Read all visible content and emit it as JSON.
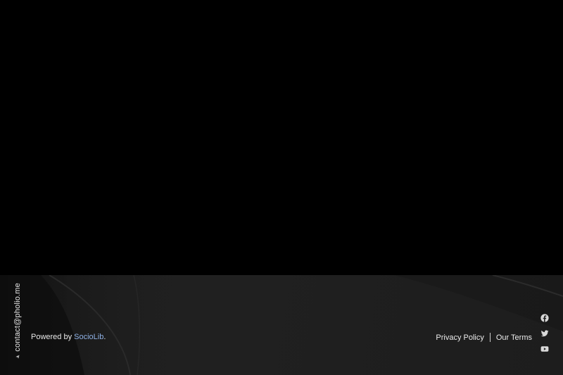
{
  "footer": {
    "contact_email": "contact@pholio.me",
    "powered_prefix": "Powered by",
    "powered_brand": "SocioLib",
    "powered_suffix": ".",
    "links": [
      {
        "label": "Privacy Policy"
      },
      {
        "label": "Our Terms"
      }
    ],
    "socials": [
      {
        "icon": "facebook-icon"
      },
      {
        "icon": "twitter-icon"
      },
      {
        "icon": "youtube-icon"
      }
    ]
  },
  "colors": {
    "page_background": "#000000",
    "footer_background": "#1f1f1f",
    "brand_link": "#8fb2e6",
    "text": "#e8e8e8"
  }
}
